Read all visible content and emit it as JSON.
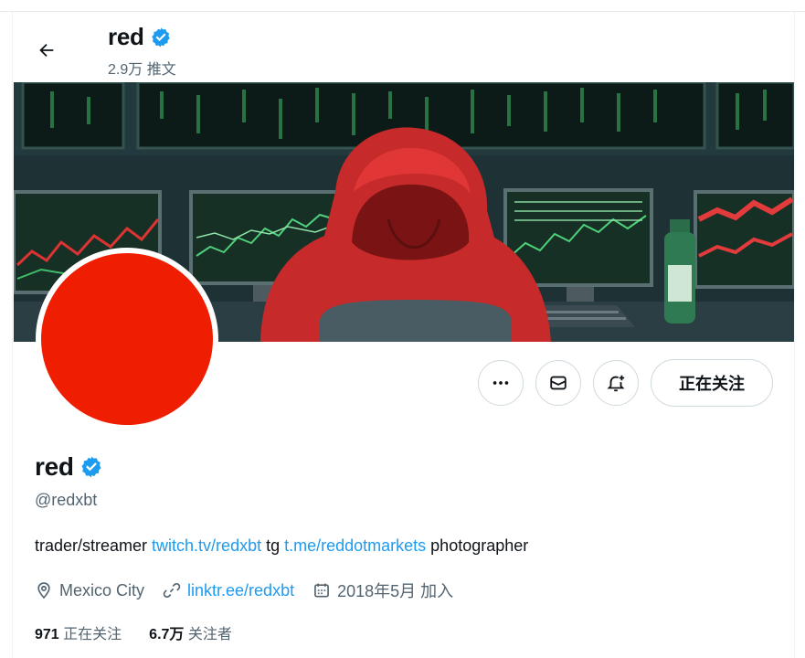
{
  "header": {
    "name": "red",
    "tweet_count": "2.9万 推文"
  },
  "profile": {
    "name": "red",
    "handle": "@redxbt",
    "bio": {
      "text1": "trader/streamer ",
      "link1": "twitch.tv/redxbt",
      "text2": " tg ",
      "link2": "t.me/reddotmarkets",
      "text3": " photographer"
    },
    "location": "Mexico City",
    "website": "linktr.ee/redxbt",
    "joined": "2018年5月 加入",
    "following_count": "971",
    "following_label": "正在关注",
    "followers_count": "6.7万",
    "followers_label": "关注者"
  },
  "actions": {
    "follow_label": "正在关注"
  },
  "icons": [
    "back-arrow-icon",
    "verified-badge-icon",
    "more-icon",
    "message-icon",
    "notify-icon",
    "location-icon",
    "link-icon",
    "calendar-icon"
  ],
  "colors": {
    "accent": "#1d9bf0",
    "avatar": "#f01e00",
    "hood": "#c62a2a",
    "secondary_text": "#536471"
  }
}
